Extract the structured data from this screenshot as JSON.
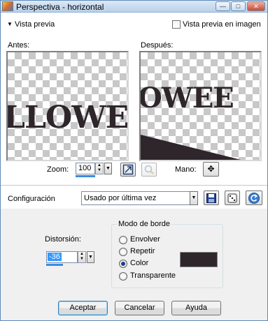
{
  "window": {
    "title": "Perspectiva - horizontal"
  },
  "preview": {
    "toggle_label": "Vista previa",
    "in_image_label": "Vista previa en imagen",
    "before_label": "Antes:",
    "after_label": "Después:"
  },
  "before_text": "LLOWE",
  "after_text": "OWEE",
  "zoom": {
    "label": "Zoom:",
    "value": "100"
  },
  "mano_label": "Mano:",
  "config": {
    "label": "Configuración",
    "value": "Usado por última vez"
  },
  "distortion": {
    "label": "Distorsión:",
    "value": "-36"
  },
  "border_mode": {
    "title": "Modo de borde",
    "options": [
      "Envolver",
      "Repetir",
      "Color",
      "Transparente"
    ],
    "selected": "Color",
    "color": "#2e262b"
  },
  "buttons": {
    "ok": "Aceptar",
    "cancel": "Cancelar",
    "help": "Ayuda"
  }
}
